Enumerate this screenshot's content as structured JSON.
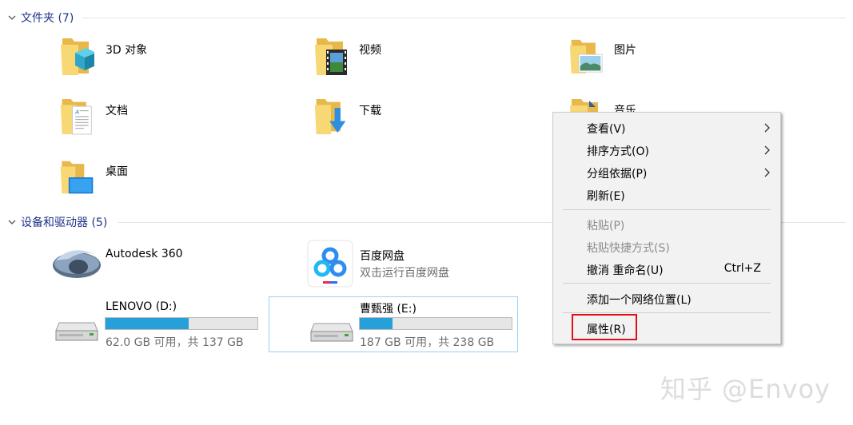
{
  "sections": {
    "folders": {
      "title": "文件夹 (7)"
    },
    "devices": {
      "title": "设备和驱动器 (5)"
    }
  },
  "folders": [
    {
      "label": "3D 对象",
      "icon": "3d-objects-icon"
    },
    {
      "label": "视频",
      "icon": "videos-icon"
    },
    {
      "label": "图片",
      "icon": "pictures-icon"
    },
    {
      "label": "文档",
      "icon": "documents-icon"
    },
    {
      "label": "下载",
      "icon": "downloads-icon"
    },
    {
      "label": "音乐",
      "icon": "music-icon"
    },
    {
      "label": "桌面",
      "icon": "desktop-icon"
    }
  ],
  "devices": [
    {
      "label": "Autodesk 360",
      "icon": "autodesk-360-icon"
    },
    {
      "label": "百度网盘",
      "sub": "双击运行百度网盘",
      "icon": "baidu-netdisk-icon"
    }
  ],
  "drives": [
    {
      "label": "LENOVO (D:)",
      "usage": "62.0 GB 可用，共 137 GB",
      "used_fraction": 0.547,
      "icon": "hard-drive-icon"
    },
    {
      "label": "曹甄强 (E:)",
      "usage": "187 GB 可用，共 238 GB",
      "used_fraction": 0.214,
      "icon": "hard-drive-icon",
      "selected": true
    }
  ],
  "context_menu": {
    "view": "查看(V)",
    "sort": "排序方式(O)",
    "group": "分组依据(P)",
    "refresh": "刷新(E)",
    "paste": "粘贴(P)",
    "paste_shortcut": "粘贴快捷方式(S)",
    "undo": "撤消 重命名(U)",
    "undo_shortcut": "Ctrl+Z",
    "add_network": "添加一个网络位置(L)",
    "properties": "属性(R)"
  },
  "watermark": "知乎 @Envoy",
  "colors": {
    "section_title": "#1e3287",
    "drive_bar_fill": "#26a0da",
    "selection_border": "#99d1ff",
    "highlight_box": "#e0101a"
  }
}
